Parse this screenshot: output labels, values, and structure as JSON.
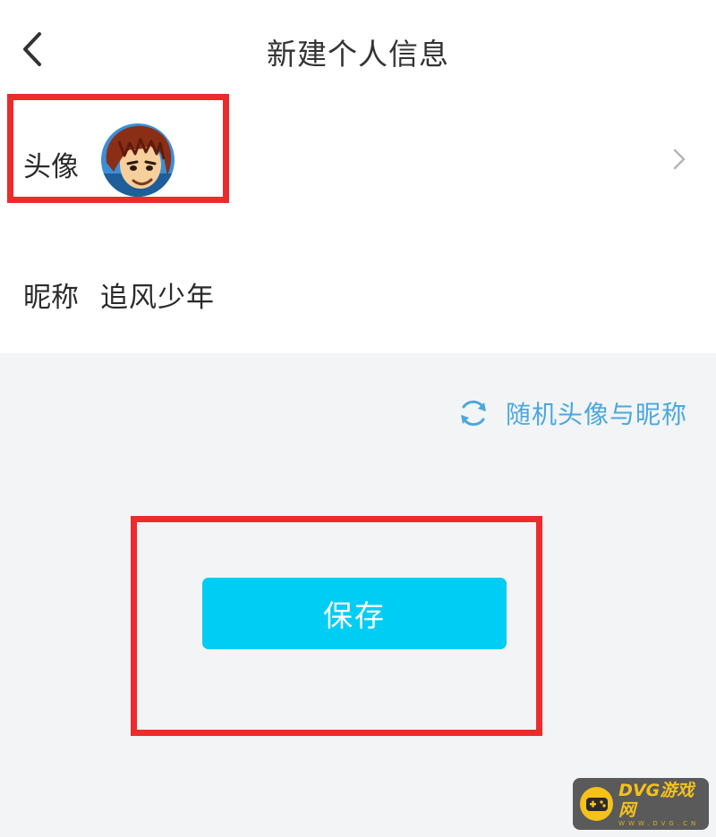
{
  "header": {
    "title": "新建个人信息"
  },
  "profile": {
    "avatar_label": "头像",
    "nickname_label": "昵称",
    "nickname_value": "追风少年"
  },
  "random": {
    "label": "随机头像与昵称"
  },
  "actions": {
    "save_label": "保存"
  },
  "watermark": {
    "text": "DVG游戏网",
    "sub": "WWW.DVG.CN"
  },
  "colors": {
    "accent": "#00cdf4",
    "link": "#4aa8df",
    "highlight": "#ee2b2b",
    "background": "#f3f4f6"
  },
  "icons": {
    "back": "chevron-left-icon",
    "row_arrow": "chevron-right-icon",
    "random": "refresh-icon"
  }
}
